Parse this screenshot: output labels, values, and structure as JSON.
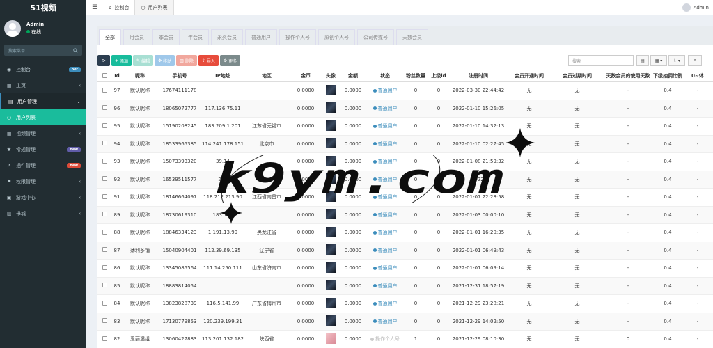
{
  "brand": "51视频",
  "user": {
    "name": "Admin",
    "status": "在线"
  },
  "sidebar_search": {
    "placeholder": "搜索菜单"
  },
  "menu": [
    {
      "icon": "dashboard-icon",
      "glyph": "◉",
      "label": "控制台",
      "badge": "hot",
      "badge_class": "hot",
      "chev": "",
      "state": ""
    },
    {
      "icon": "home-icon",
      "glyph": "▦",
      "label": "主页",
      "badge": "",
      "badge_class": "",
      "chev": "‹",
      "state": ""
    },
    {
      "icon": "users-icon",
      "glyph": "▤",
      "label": "用户管理",
      "badge": "",
      "badge_class": "",
      "chev": "⌄",
      "state": "open"
    },
    {
      "icon": "circle-icon",
      "glyph": "○",
      "label": "用户列表",
      "badge": "",
      "badge_class": "",
      "chev": "",
      "state": "active"
    },
    {
      "icon": "video-icon",
      "glyph": "▦",
      "label": "视频管理",
      "badge": "",
      "badge_class": "",
      "chev": "‹",
      "state": ""
    },
    {
      "icon": "cog-icon",
      "glyph": "✱",
      "label": "常规管理",
      "badge": "new",
      "badge_class": "new1",
      "chev": "",
      "state": ""
    },
    {
      "icon": "rocket-icon",
      "glyph": "➚",
      "label": "插件管理",
      "badge": "new",
      "badge_class": "new2",
      "chev": "",
      "state": ""
    },
    {
      "icon": "group-icon",
      "glyph": "⚑",
      "label": "权限管理",
      "badge": "",
      "badge_class": "",
      "chev": "‹",
      "state": ""
    },
    {
      "icon": "game-icon",
      "glyph": "▣",
      "label": "游戏中心",
      "badge": "",
      "badge_class": "",
      "chev": "‹",
      "state": ""
    },
    {
      "icon": "book-icon",
      "glyph": "▥",
      "label": "书城",
      "badge": "",
      "badge_class": "",
      "chev": "‹",
      "state": ""
    }
  ],
  "topbar": {
    "tabs": [
      {
        "icon": "dashboard-icon",
        "glyph": "⌂",
        "label": "控制台",
        "active": false
      },
      {
        "icon": "circle-icon",
        "glyph": "○",
        "label": "用户列表",
        "active": true
      }
    ],
    "admin": "Admin"
  },
  "filter_tabs": [
    "全部",
    "月会员",
    "季会员",
    "年会员",
    "永久会员",
    "普通用户",
    "操作个人号",
    "原创个人号",
    "公司传媒号",
    "天数会员"
  ],
  "toolbar": {
    "add": "添加",
    "edit": "编辑",
    "move": "移动",
    "delete": "删除",
    "import": "导入",
    "more": "更多",
    "search_placeholder": "搜索"
  },
  "columns": [
    "Id",
    "昵称",
    "手机号",
    "IP地址",
    "地区",
    "金币",
    "头像",
    "金额",
    "状态",
    "粉丝数量",
    "上级id",
    "注册时间",
    "会员开通时间",
    "会员过期时间",
    "天数会员的使用天数",
    "下级抽佣比例",
    "0~体"
  ],
  "rows": [
    {
      "id": "97",
      "nick": "默认昵称",
      "phone": "17674111178",
      "ip": "",
      "region": "",
      "coin": "0.0000",
      "avatar": "dark",
      "amount": "0.0000",
      "status": "普通用户",
      "status_type": "blue",
      "fans": "0",
      "parent": "0",
      "reg": "2022-03-30 22:44:42",
      "vip_open": "无",
      "vip_exp": "无",
      "days": "-",
      "rate": "0.4",
      "extra": "-"
    },
    {
      "id": "96",
      "nick": "默认昵称",
      "phone": "18065072777",
      "ip": "117.136.75.11",
      "region": "",
      "coin": "0.0000",
      "avatar": "dark",
      "amount": "0.0000",
      "status": "普通用户",
      "status_type": "blue",
      "fans": "0",
      "parent": "0",
      "reg": "2022-01-10 15:26:05",
      "vip_open": "无",
      "vip_exp": "无",
      "days": "-",
      "rate": "0.4",
      "extra": "-"
    },
    {
      "id": "95",
      "nick": "默认昵称",
      "phone": "15190208245",
      "ip": "183.209.1.201",
      "region": "江苏省无锡市",
      "coin": "0.0000",
      "avatar": "dark",
      "amount": "0.0000",
      "status": "普通用户",
      "status_type": "blue",
      "fans": "0",
      "parent": "0",
      "reg": "2022-01-10 14:32:13",
      "vip_open": "无",
      "vip_exp": "无",
      "days": "-",
      "rate": "0.4",
      "extra": "-"
    },
    {
      "id": "94",
      "nick": "默认昵称",
      "phone": "18533965385",
      "ip": "114.241.178.151",
      "region": "北京市",
      "coin": "0.0000",
      "avatar": "dark",
      "amount": "0.0000",
      "status": "普通用户",
      "status_type": "blue",
      "fans": "0",
      "parent": "0",
      "reg": "2022-01-10 02:27:45",
      "vip_open": "无",
      "vip_exp": "无",
      "days": "-",
      "rate": "0.4",
      "extra": "-"
    },
    {
      "id": "93",
      "nick": "默认昵称",
      "phone": "15073393320",
      "ip": "39.14",
      "region": "",
      "coin": "0.0000",
      "avatar": "dark",
      "amount": "0.0000",
      "status": "普通用户",
      "status_type": "blue",
      "fans": "0",
      "parent": "0",
      "reg": "2022-01-08 21:59:32",
      "vip_open": "无",
      "vip_exp": "无",
      "days": "-",
      "rate": "0.4",
      "extra": "-"
    },
    {
      "id": "92",
      "nick": "默认昵称",
      "phone": "16539511577",
      "ip": "223",
      "region": "",
      "coin": "0.0000",
      "avatar": "dark",
      "amount": "0.0000",
      "status": "普通用户",
      "status_type": "blue",
      "fans": "0",
      "parent": "0",
      "reg": "2022-",
      "vip_open": "无",
      "vip_exp": "无",
      "days": "-",
      "rate": "0.4",
      "extra": "-"
    },
    {
      "id": "91",
      "nick": "默认昵称",
      "phone": "18146664097",
      "ip": "118.212.213.90",
      "region": "江西省南昌市",
      "coin": "0.0000",
      "avatar": "dark",
      "amount": "0.0000",
      "status": "普通用户",
      "status_type": "blue",
      "fans": "0",
      "parent": "0",
      "reg": "2022-01-07 22:28:58",
      "vip_open": "无",
      "vip_exp": "无",
      "days": "-",
      "rate": "0.4",
      "extra": "-"
    },
    {
      "id": "89",
      "nick": "默认昵称",
      "phone": "18730619310",
      "ip": "183.199",
      "region": "",
      "coin": "0.0000",
      "avatar": "dark",
      "amount": "0.0000",
      "status": "普通用户",
      "status_type": "blue",
      "fans": "0",
      "parent": "0",
      "reg": "2022-01-03 00:00:10",
      "vip_open": "无",
      "vip_exp": "无",
      "days": "-",
      "rate": "0.4",
      "extra": "-"
    },
    {
      "id": "88",
      "nick": "默认昵称",
      "phone": "18846334123",
      "ip": "1.191.13.99",
      "region": "黑龙江省",
      "coin": "0.0000",
      "avatar": "dark",
      "amount": "0.0000",
      "status": "普通用户",
      "status_type": "blue",
      "fans": "0",
      "parent": "0",
      "reg": "2022-01-01 16:20:35",
      "vip_open": "无",
      "vip_exp": "无",
      "days": "-",
      "rate": "0.4",
      "extra": "-"
    },
    {
      "id": "87",
      "nick": "薄利多销",
      "phone": "15040904401",
      "ip": "112.39.69.135",
      "region": "辽宁省",
      "coin": "0.0000",
      "avatar": "dark",
      "amount": "0.0000",
      "status": "普通用户",
      "status_type": "blue",
      "fans": "0",
      "parent": "0",
      "reg": "2022-01-01 06:49:43",
      "vip_open": "无",
      "vip_exp": "无",
      "days": "-",
      "rate": "0.4",
      "extra": "-"
    },
    {
      "id": "86",
      "nick": "默认昵称",
      "phone": "13345085564",
      "ip": "111.14.250.111",
      "region": "山东省济南市",
      "coin": "0.0000",
      "avatar": "dark",
      "amount": "0.0000",
      "status": "普通用户",
      "status_type": "blue",
      "fans": "0",
      "parent": "0",
      "reg": "2022-01-01 06:09:14",
      "vip_open": "无",
      "vip_exp": "无",
      "days": "-",
      "rate": "0.4",
      "extra": "-"
    },
    {
      "id": "85",
      "nick": "默认昵称",
      "phone": "18883814054",
      "ip": "",
      "region": "",
      "coin": "0.0000",
      "avatar": "dark",
      "amount": "0.0000",
      "status": "普通用户",
      "status_type": "blue",
      "fans": "0",
      "parent": "0",
      "reg": "2021-12-31 18:57:19",
      "vip_open": "无",
      "vip_exp": "无",
      "days": "-",
      "rate": "0.4",
      "extra": "-"
    },
    {
      "id": "84",
      "nick": "默认昵称",
      "phone": "13823828739",
      "ip": "116.5.141.99",
      "region": "广东省梅州市",
      "coin": "0.0000",
      "avatar": "dark",
      "amount": "0.0000",
      "status": "普通用户",
      "status_type": "blue",
      "fans": "0",
      "parent": "0",
      "reg": "2021-12-29 23:28:21",
      "vip_open": "无",
      "vip_exp": "无",
      "days": "-",
      "rate": "0.4",
      "extra": "-"
    },
    {
      "id": "83",
      "nick": "默认昵称",
      "phone": "17130779853",
      "ip": "120.239.199.31",
      "region": "",
      "coin": "0.0000",
      "avatar": "dark",
      "amount": "0.0000",
      "status": "普通用户",
      "status_type": "blue",
      "fans": "0",
      "parent": "0",
      "reg": "2021-12-29 14:02:50",
      "vip_open": "无",
      "vip_exp": "无",
      "days": "-",
      "rate": "0.4",
      "extra": "-"
    },
    {
      "id": "82",
      "nick": "爱丽湿组",
      "phone": "13060427883",
      "ip": "113.201.132.182",
      "region": "陕西省",
      "coin": "0.0000",
      "avatar": "pink",
      "amount": "0.0000",
      "status": "操作个人号",
      "status_type": "gray",
      "fans": "1",
      "parent": "0",
      "reg": "2021-12-29 08:10:30",
      "vip_open": "无",
      "vip_exp": "无",
      "days": "0",
      "rate": "0.4",
      "extra": "-"
    }
  ],
  "watermark": "k9ym.com",
  "colors": {
    "sidebar": "#222d32",
    "active": "#1abc9c",
    "accent": "#3c8dbc",
    "danger": "#e74c3c"
  }
}
